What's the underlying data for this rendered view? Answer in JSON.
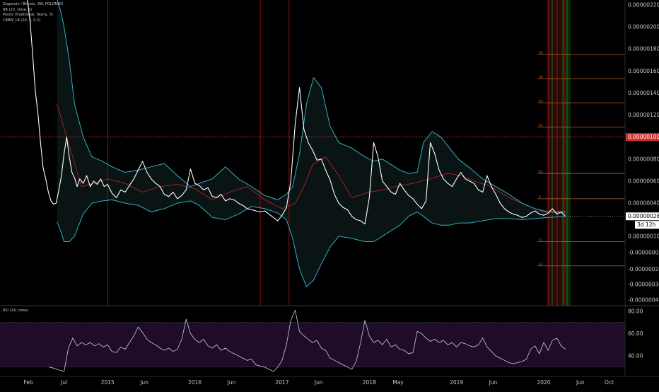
{
  "chart_data": [
    {
      "type": "line",
      "legend": [
        "Dogecoin / Bitcoin, 3W, POLONIEX",
        "BB (20, close, 2)",
        "Pivots (Traditional, Yearly, 3)",
        "CBBW_LB (20, 2, 0.2)"
      ],
      "price_ticks": [
        "0.00000220",
        "0.00000200",
        "0.00000180",
        "0.00000160",
        "0.00000140",
        "0.00000120",
        "0.00000100",
        "0.00000080",
        "0.00000060",
        "0.00000040",
        "0.00000028",
        "0.00000010",
        "-0.00000005",
        "-0.00000020",
        "-0.00000034",
        "-0.00000048"
      ],
      "price_tick_values": [
        2.2,
        2.0,
        1.8,
        1.6,
        1.4,
        1.2,
        1.0,
        0.8,
        0.6,
        0.4,
        0.28,
        0.1,
        -0.05,
        -0.2,
        -0.34,
        -0.48
      ],
      "highlight_label": "0.00000100",
      "highlight_value": 1.0,
      "last_price_label": "0.00000028",
      "last_price_value": 0.28,
      "countdown_label": "3d 12h",
      "x_ticks": [
        "Feb",
        "Jul",
        "2015",
        "Jun",
        "2016",
        "Jun",
        "2017",
        "Jun",
        "2018",
        "May",
        "2019",
        "Jun",
        "2020",
        "Jun",
        "Oct"
      ],
      "x_tick_years": [
        2014.09,
        2014.5,
        2015.0,
        2015.42,
        2016.0,
        2016.42,
        2017.0,
        2017.42,
        2018.0,
        2018.33,
        2019.0,
        2019.42,
        2020.0,
        2020.42,
        2020.75
      ],
      "vertical_markers_years": [
        2015.0,
        2016.75,
        2017.08
      ],
      "pivot_labels": [
        "R5",
        "R4",
        "R3",
        "R2",
        "R1",
        "P",
        "S1",
        "S2"
      ],
      "pivot_values": [
        1.75,
        1.53,
        1.31,
        1.09,
        0.67,
        0.44,
        0.05,
        -0.17
      ],
      "series": [
        {
          "name": "Dogecoin / Bitcoin",
          "color": "#ffffff",
          "x": [
            2014.08,
            2014.11,
            2014.14,
            2014.17,
            2014.2,
            2014.23,
            2014.26,
            2014.29,
            2014.32,
            2014.35,
            2014.38,
            2014.41,
            2014.44,
            2014.47,
            2014.5,
            2014.53,
            2014.56,
            2014.59,
            2014.62,
            2014.65,
            2014.68,
            2014.72,
            2014.76,
            2014.8,
            2014.84,
            2014.88,
            2014.92,
            2014.96,
            2015.0,
            2015.05,
            2015.1,
            2015.15,
            2015.2,
            2015.25,
            2015.3,
            2015.35,
            2015.4,
            2015.45,
            2015.5,
            2015.55,
            2015.6,
            2015.65,
            2015.7,
            2015.75,
            2015.8,
            2015.85,
            2015.9,
            2015.95,
            2016.0,
            2016.05,
            2016.1,
            2016.15,
            2016.2,
            2016.25,
            2016.3,
            2016.35,
            2016.4,
            2016.45,
            2016.5,
            2016.55,
            2016.6,
            2016.65,
            2016.7,
            2016.75,
            2016.8,
            2016.85,
            2016.9,
            2016.95,
            2017.0,
            2017.05,
            2017.1,
            2017.15,
            2017.2,
            2017.25,
            2017.3,
            2017.35,
            2017.4,
            2017.45,
            2017.5,
            2017.55,
            2017.6,
            2017.65,
            2017.7,
            2017.75,
            2017.8,
            2017.85,
            2017.9,
            2017.95,
            2018.0,
            2018.05,
            2018.1,
            2018.15,
            2018.2,
            2018.25,
            2018.3,
            2018.35,
            2018.4,
            2018.45,
            2018.5,
            2018.55,
            2018.6,
            2018.65,
            2018.7,
            2018.75,
            2018.8,
            2018.85,
            2018.9,
            2018.95,
            2019.0,
            2019.05,
            2019.1,
            2019.15,
            2019.2,
            2019.25,
            2019.3,
            2019.35,
            2019.4,
            2019.45,
            2019.5,
            2019.55,
            2019.6,
            2019.65,
            2019.7,
            2019.75,
            2019.8,
            2019.85,
            2019.9,
            2019.95,
            2020.0,
            2020.05,
            2020.1,
            2020.15,
            2020.2,
            2020.25
          ],
          "values": [
            2.25,
            2.05,
            1.75,
            1.42,
            1.22,
            0.95,
            0.72,
            0.62,
            0.5,
            0.42,
            0.39,
            0.4,
            0.52,
            0.65,
            0.85,
            1.0,
            0.82,
            0.68,
            0.63,
            0.55,
            0.62,
            0.58,
            0.65,
            0.55,
            0.6,
            0.57,
            0.62,
            0.55,
            0.57,
            0.49,
            0.45,
            0.52,
            0.5,
            0.56,
            0.62,
            0.7,
            0.78,
            0.68,
            0.62,
            0.58,
            0.55,
            0.48,
            0.46,
            0.5,
            0.44,
            0.47,
            0.52,
            0.71,
            0.58,
            0.56,
            0.52,
            0.54,
            0.46,
            0.45,
            0.48,
            0.42,
            0.44,
            0.43,
            0.4,
            0.38,
            0.35,
            0.34,
            0.33,
            0.32,
            0.33,
            0.3,
            0.27,
            0.24,
            0.29,
            0.36,
            0.6,
            1.12,
            1.45,
            1.07,
            0.95,
            0.88,
            0.79,
            0.8,
            0.7,
            0.61,
            0.48,
            0.4,
            0.36,
            0.34,
            0.28,
            0.25,
            0.24,
            0.21,
            0.45,
            0.95,
            0.82,
            0.6,
            0.55,
            0.5,
            0.48,
            0.58,
            0.52,
            0.47,
            0.44,
            0.39,
            0.35,
            0.42,
            0.95,
            0.85,
            0.7,
            0.62,
            0.58,
            0.55,
            0.62,
            0.68,
            0.62,
            0.6,
            0.58,
            0.52,
            0.5,
            0.65,
            0.55,
            0.48,
            0.4,
            0.35,
            0.32,
            0.3,
            0.29,
            0.27,
            0.28,
            0.31,
            0.33,
            0.3,
            0.29,
            0.31,
            0.35,
            0.3,
            0.32,
            0.28
          ]
        },
        {
          "name": "BB basis",
          "color": "#b22222",
          "x": [
            2014.42,
            2014.55,
            2014.7,
            2014.85,
            2015.0,
            2015.2,
            2015.4,
            2015.6,
            2015.8,
            2016.0,
            2016.2,
            2016.4,
            2016.6,
            2016.8,
            2017.0,
            2017.15,
            2017.25,
            2017.35,
            2017.5,
            2017.65,
            2017.8,
            2018.0,
            2018.15,
            2018.3,
            2018.5,
            2018.7,
            2018.9,
            2019.05,
            2019.2,
            2019.4,
            2019.6,
            2019.8,
            2020.0,
            2020.25
          ],
          "values": [
            1.3,
            0.95,
            0.55,
            0.58,
            0.62,
            0.58,
            0.5,
            0.55,
            0.57,
            0.53,
            0.43,
            0.5,
            0.55,
            0.43,
            0.35,
            0.4,
            0.55,
            0.75,
            0.82,
            0.65,
            0.45,
            0.5,
            0.52,
            0.55,
            0.58,
            0.62,
            0.67,
            0.65,
            0.6,
            0.55,
            0.45,
            0.38,
            0.32,
            0.31
          ]
        },
        {
          "name": "BB upper",
          "color": "#2fb0c0",
          "x": [
            2014.42,
            2014.46,
            2014.5,
            2014.56,
            2014.62,
            2014.72,
            2014.82,
            2014.94,
            2015.05,
            2015.2,
            2015.35,
            2015.5,
            2015.65,
            2015.8,
            2015.95,
            2016.05,
            2016.2,
            2016.35,
            2016.5,
            2016.65,
            2016.8,
            2016.95,
            2017.05,
            2017.12,
            2017.2,
            2017.28,
            2017.36,
            2017.45,
            2017.55,
            2017.65,
            2017.8,
            2017.95,
            2018.05,
            2018.15,
            2018.25,
            2018.35,
            2018.45,
            2018.55,
            2018.62,
            2018.72,
            2018.82,
            2018.92,
            2019.02,
            2019.15,
            2019.3,
            2019.45,
            2019.6,
            2019.75,
            2019.9,
            2020.05,
            2020.25
          ],
          "values": [
            2.25,
            2.15,
            2.0,
            1.7,
            1.3,
            1.0,
            0.82,
            0.78,
            0.73,
            0.68,
            0.7,
            0.73,
            0.76,
            0.65,
            0.55,
            0.58,
            0.62,
            0.73,
            0.62,
            0.55,
            0.47,
            0.43,
            0.48,
            0.55,
            0.85,
            1.3,
            1.54,
            1.45,
            1.1,
            0.95,
            0.9,
            0.82,
            0.78,
            0.8,
            0.75,
            0.7,
            0.67,
            0.68,
            0.95,
            1.05,
            1.0,
            0.9,
            0.8,
            0.72,
            0.62,
            0.55,
            0.48,
            0.4,
            0.35,
            0.32,
            0.32
          ]
        },
        {
          "name": "BB lower",
          "color": "#2fb0c0",
          "x": [
            2014.42,
            2014.46,
            2014.5,
            2014.56,
            2014.62,
            2014.72,
            2014.82,
            2014.94,
            2015.05,
            2015.2,
            2015.35,
            2015.5,
            2015.65,
            2015.8,
            2015.95,
            2016.05,
            2016.2,
            2016.35,
            2016.5,
            2016.65,
            2016.8,
            2016.95,
            2017.05,
            2017.12,
            2017.2,
            2017.28,
            2017.36,
            2017.45,
            2017.55,
            2017.65,
            2017.8,
            2017.95,
            2018.05,
            2018.15,
            2018.25,
            2018.35,
            2018.45,
            2018.55,
            2018.62,
            2018.72,
            2018.82,
            2018.92,
            2019.02,
            2019.15,
            2019.3,
            2019.45,
            2019.6,
            2019.75,
            2019.9,
            2020.05,
            2020.25
          ],
          "values": [
            0.23,
            0.15,
            0.05,
            0.05,
            0.1,
            0.3,
            0.4,
            0.42,
            0.43,
            0.4,
            0.38,
            0.32,
            0.35,
            0.4,
            0.42,
            0.38,
            0.27,
            0.25,
            0.3,
            0.37,
            0.35,
            0.31,
            0.25,
            0.08,
            -0.2,
            -0.36,
            -0.3,
            -0.15,
            0.0,
            0.1,
            0.08,
            0.05,
            0.05,
            0.1,
            0.15,
            0.2,
            0.28,
            0.32,
            0.28,
            0.22,
            0.2,
            0.2,
            0.22,
            0.22,
            0.24,
            0.26,
            0.26,
            0.25,
            0.26,
            0.27,
            0.28
          ]
        }
      ],
      "band_fill": "#0c1616"
    },
    {
      "type": "line",
      "title": "RSI (14, close)",
      "y_ticks": [
        "80.00",
        "60.00",
        "40.00"
      ],
      "y_tick_values": [
        80,
        60,
        40
      ],
      "bands": [
        70,
        30
      ],
      "ylim": [
        20,
        82
      ],
      "series": [
        {
          "name": "RSI",
          "color": "#d0d0d0",
          "x": [
            2014.33,
            2014.38,
            2014.42,
            2014.46,
            2014.5,
            2014.55,
            2014.6,
            2014.65,
            2014.7,
            2014.75,
            2014.8,
            2014.85,
            2014.9,
            2014.95,
            2015.0,
            2015.05,
            2015.1,
            2015.15,
            2015.2,
            2015.25,
            2015.3,
            2015.35,
            2015.4,
            2015.45,
            2015.5,
            2015.55,
            2015.6,
            2015.65,
            2015.7,
            2015.75,
            2015.8,
            2015.85,
            2015.9,
            2015.95,
            2016.0,
            2016.05,
            2016.1,
            2016.15,
            2016.2,
            2016.25,
            2016.3,
            2016.35,
            2016.4,
            2016.45,
            2016.5,
            2016.55,
            2016.6,
            2016.65,
            2016.7,
            2016.75,
            2016.8,
            2016.85,
            2016.9,
            2016.95,
            2017.0,
            2017.05,
            2017.1,
            2017.15,
            2017.2,
            2017.25,
            2017.3,
            2017.35,
            2017.4,
            2017.45,
            2017.5,
            2017.55,
            2017.6,
            2017.65,
            2017.7,
            2017.75,
            2017.8,
            2017.85,
            2017.9,
            2017.95,
            2018.0,
            2018.05,
            2018.1,
            2018.15,
            2018.2,
            2018.25,
            2018.3,
            2018.35,
            2018.4,
            2018.45,
            2018.5,
            2018.55,
            2018.6,
            2018.65,
            2018.7,
            2018.75,
            2018.8,
            2018.85,
            2018.9,
            2018.95,
            2019.0,
            2019.05,
            2019.1,
            2019.15,
            2019.2,
            2019.25,
            2019.3,
            2019.35,
            2019.4,
            2019.45,
            2019.5,
            2019.55,
            2019.6,
            2019.65,
            2019.7,
            2019.75,
            2019.8,
            2019.85,
            2019.9,
            2019.95,
            2020.0,
            2020.05,
            2020.1,
            2020.15,
            2020.2,
            2020.25
          ],
          "values": [
            30,
            29,
            28,
            27,
            26,
            47,
            56,
            49,
            52,
            50,
            52,
            49,
            51,
            48,
            50,
            44,
            43,
            48,
            46,
            52,
            58,
            66,
            61,
            55,
            52,
            50,
            47,
            45,
            47,
            44,
            46,
            55,
            73,
            60,
            55,
            52,
            55,
            49,
            47,
            50,
            45,
            47,
            44,
            42,
            40,
            38,
            36,
            37,
            32,
            31,
            30,
            28,
            26,
            30,
            36,
            50,
            72,
            81,
            62,
            58,
            55,
            52,
            54,
            47,
            45,
            38,
            36,
            34,
            32,
            30,
            28,
            35,
            52,
            72,
            58,
            52,
            54,
            50,
            55,
            48,
            50,
            46,
            45,
            42,
            43,
            62,
            60,
            56,
            53,
            55,
            52,
            54,
            50,
            52,
            48,
            52,
            51,
            49,
            48,
            50,
            56,
            48,
            44,
            40,
            38,
            36,
            34,
            33,
            34,
            35,
            37,
            46,
            49,
            42,
            52,
            45,
            54,
            56,
            49,
            46
          ]
        }
      ]
    }
  ]
}
